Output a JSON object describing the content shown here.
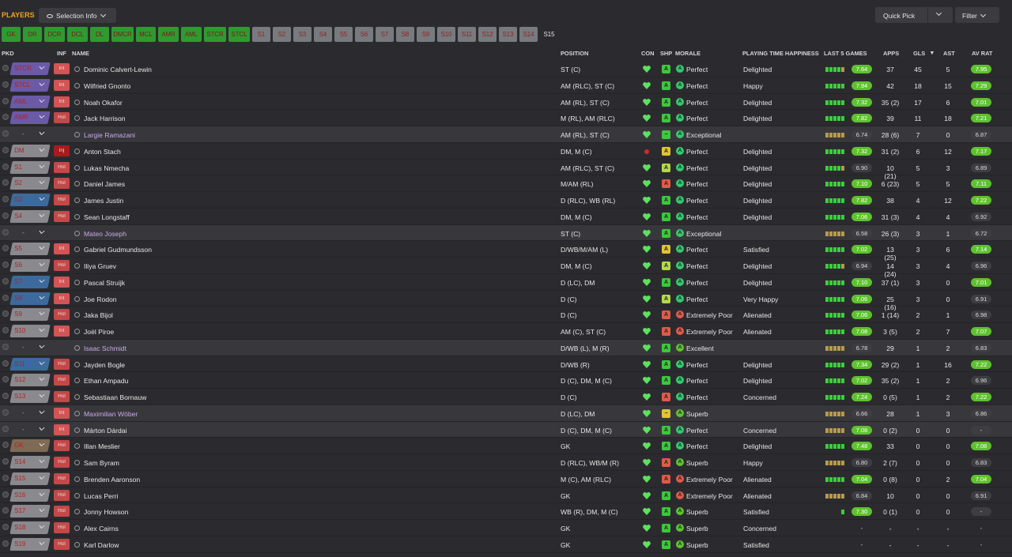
{
  "header": {
    "title": "PLAYERS",
    "selection_info": "Selection Info",
    "quick_pick": "Quick Pick",
    "filter": "Filter"
  },
  "tabs": [
    {
      "label": "GK",
      "style": "g"
    },
    {
      "label": "DR",
      "style": "g"
    },
    {
      "label": "DCR",
      "style": "g"
    },
    {
      "label": "DCL",
      "style": "g"
    },
    {
      "label": "DL",
      "style": "g"
    },
    {
      "label": "DMCR",
      "style": "g"
    },
    {
      "label": "MCL",
      "style": "g"
    },
    {
      "label": "AMR",
      "style": "g"
    },
    {
      "label": "AML",
      "style": "g"
    },
    {
      "label": "STCR",
      "style": "g"
    },
    {
      "label": "STCL",
      "style": "g"
    },
    {
      "label": "S1",
      "style": "n"
    },
    {
      "label": "S2",
      "style": "n"
    },
    {
      "label": "S3",
      "style": "n"
    },
    {
      "label": "S4",
      "style": "n"
    },
    {
      "label": "S5",
      "style": "n"
    },
    {
      "label": "S6",
      "style": "n"
    },
    {
      "label": "S7",
      "style": "n"
    },
    {
      "label": "S8",
      "style": "n"
    },
    {
      "label": "S9",
      "style": "n"
    },
    {
      "label": "S10",
      "style": "n"
    },
    {
      "label": "S11",
      "style": "n"
    },
    {
      "label": "S12",
      "style": "n"
    },
    {
      "label": "S13",
      "style": "n"
    },
    {
      "label": "S14",
      "style": "n"
    },
    {
      "label": "S15",
      "style": "a"
    }
  ],
  "columns": {
    "pkd": "PKD",
    "inf": "INF",
    "name": "NAME",
    "position": "POSITION",
    "con": "CON",
    "shp": "SHP",
    "morale": "MORALE",
    "pth": "PLAYING TIME HAPPINESS",
    "last5": "LAST 5 GAMES",
    "apps": "APPS",
    "gls": "GLS",
    "ast": "AST",
    "avrat": "AV RAT"
  },
  "colors": {
    "accent": "#f0a21d",
    "rating_high": "#5ec22e",
    "green_tab": "#2f9a2f",
    "grey_tab": "#777a7e"
  },
  "players": [
    {
      "slot": "STCR",
      "slotc": "pur",
      "inf": "Int",
      "name": "Dominic Calvert-Lewin",
      "pos": "ST (C)",
      "con": "h",
      "shp": "A",
      "shc": "#3cc83c",
      "moi": "A",
      "moc": "#35c96a",
      "morale": "Perfect",
      "pth": "Delighted",
      "l5": "hhhhg",
      "rate": "7.64",
      "rc": "hi",
      "apps": "37",
      "gls": "45",
      "ast": "5",
      "av": "7.95",
      "ac": "hi",
      "nc": ""
    },
    {
      "slot": "STCL",
      "slotc": "pur",
      "inf": "Int",
      "name": "Wilfried Gnonto",
      "pos": "AM (RLC), ST (C)",
      "con": "h",
      "shp": "A",
      "shc": "#3cc83c",
      "moi": "A",
      "moc": "#35c96a",
      "morale": "Perfect",
      "pth": "Happy",
      "l5": "hhhhh",
      "rate": "7.94",
      "rc": "hi",
      "apps": "42",
      "gls": "18",
      "ast": "15",
      "av": "7.29",
      "ac": "hi",
      "nc": ""
    },
    {
      "slot": "AML",
      "slotc": "pur",
      "inf": "Int",
      "name": "Noah Okafor",
      "pos": "AM (RL), ST (C)",
      "con": "h",
      "shp": "A",
      "shc": "#3cc83c",
      "moi": "A",
      "moc": "#35c96a",
      "morale": "Perfect",
      "pth": "Delighted",
      "l5": "hhhhh",
      "rate": "7.32",
      "rc": "hi",
      "apps": "35 (2)",
      "gls": "17",
      "ast": "6",
      "av": "7.01",
      "ac": "hi",
      "nc": ""
    },
    {
      "slot": "AMR",
      "slotc": "pur",
      "inf": "Hol",
      "name": "Jack Harrison",
      "pos": "M (RL), AM (RLC)",
      "con": "h",
      "shp": "A",
      "shc": "#3cc83c",
      "moi": "A",
      "moc": "#35c96a",
      "morale": "Perfect",
      "pth": "Delighted",
      "l5": "hhhhh",
      "rate": "7.82",
      "rc": "hi",
      "apps": "39",
      "gls": "11",
      "ast": "18",
      "av": "7.21",
      "ac": "hi",
      "nc": ""
    },
    {
      "slot": "-",
      "slotc": "non",
      "inf": "",
      "name": "Largie Ramazani",
      "pos": "AM (RL), ST (C)",
      "con": "h",
      "shp": "−",
      "shc": "#3cc83c",
      "moi": "A",
      "moc": "#35c96a",
      "morale": "Exceptional",
      "pth": "",
      "l5": "ggggg",
      "rate": "6.74",
      "rc": "lo",
      "apps": "28 (6)",
      "gls": "7",
      "ast": "0",
      "av": "6.87",
      "ac": "lo",
      "nc": "pur",
      "alt": true
    },
    {
      "slot": "DM",
      "slotc": "gry",
      "inf": "Inj",
      "name": "Anton Stach",
      "pos": "DM, M (C)",
      "con": "dot",
      "shp": "A",
      "shc": "#e0c435",
      "moi": "A",
      "moc": "#35c96a",
      "morale": "Perfect",
      "pth": "Delighted",
      "l5": "hhhhh",
      "rate": "7.32",
      "rc": "hi",
      "apps": "31 (2)",
      "gls": "6",
      "ast": "12",
      "av": "7.17",
      "ac": "hi",
      "nc": ""
    },
    {
      "slot": "S1",
      "slotc": "gry",
      "inf": "Hol",
      "name": "Lukas Nmecha",
      "pos": "AM (RLC), ST (C)",
      "con": "h",
      "shp": "A",
      "shc": "#b3d94a",
      "moi": "A",
      "moc": "#35c96a",
      "morale": "Perfect",
      "pth": "Delighted",
      "l5": "hhhhg",
      "rate": "6.90",
      "rc": "lo",
      "apps": "10 (21)",
      "gls": "5",
      "ast": "3",
      "av": "6.89",
      "ac": "lo",
      "nc": ""
    },
    {
      "slot": "S2",
      "slotc": "gry",
      "inf": "Hol",
      "name": "Daniel James",
      "pos": "M/AM (RL)",
      "con": "h",
      "shp": "A",
      "shc": "#e05a4a",
      "moi": "A",
      "moc": "#35c96a",
      "morale": "Perfect",
      "pth": "Delighted",
      "l5": "hhhhh",
      "rate": "7.10",
      "rc": "hi",
      "apps": "6 (23)",
      "gls": "5",
      "ast": "5",
      "av": "7.11",
      "ac": "hi",
      "nc": ""
    },
    {
      "slot": "S3",
      "slotc": "blu",
      "inf": "Hol",
      "name": "James Justin",
      "pos": "D (RLC), WB (RL)",
      "con": "h",
      "shp": "A",
      "shc": "#3cc83c",
      "moi": "A",
      "moc": "#35c96a",
      "morale": "Perfect",
      "pth": "Delighted",
      "l5": "hhhhh",
      "rate": "7.82",
      "rc": "hi",
      "apps": "38",
      "gls": "4",
      "ast": "12",
      "av": "7.22",
      "ac": "hi",
      "nc": ""
    },
    {
      "slot": "S4",
      "slotc": "gry",
      "inf": "Hol",
      "name": "Sean Longstaff",
      "pos": "DM, M (C)",
      "con": "h",
      "shp": "A",
      "shc": "#3cc83c",
      "moi": "A",
      "moc": "#35c96a",
      "morale": "Perfect",
      "pth": "Delighted",
      "l5": "hhhhh",
      "rate": "7.06",
      "rc": "hi",
      "apps": "31 (3)",
      "gls": "4",
      "ast": "4",
      "av": "6.92",
      "ac": "lo",
      "nc": ""
    },
    {
      "slot": "-",
      "slotc": "non",
      "inf": "",
      "name": "Mateo Joseph",
      "pos": "ST (C)",
      "con": "h",
      "shp": "A",
      "shc": "#3cc83c",
      "moi": "A",
      "moc": "#35c96a",
      "morale": "Exceptional",
      "pth": "",
      "l5": "ggggg",
      "rate": "6.58",
      "rc": "lo",
      "apps": "26 (3)",
      "gls": "3",
      "ast": "1",
      "av": "6.72",
      "ac": "lo",
      "nc": "pur",
      "alt": true
    },
    {
      "slot": "S5",
      "slotc": "gry",
      "inf": "Int",
      "name": "Gabriel Gudmundsson",
      "pos": "D/WB/M/AM (L)",
      "con": "h",
      "shp": "A",
      "shc": "#e0c435",
      "moi": "A",
      "moc": "#35c96a",
      "morale": "Perfect",
      "pth": "Satisfied",
      "l5": "hhhhh",
      "rate": "7.02",
      "rc": "hi",
      "apps": "13 (25)",
      "gls": "3",
      "ast": "6",
      "av": "7.14",
      "ac": "hi",
      "nc": ""
    },
    {
      "slot": "S6",
      "slotc": "gry",
      "inf": "Hol",
      "name": "Iliya Gruev",
      "pos": "DM, M (C)",
      "con": "h",
      "shp": "A",
      "shc": "#b3d94a",
      "moi": "A",
      "moc": "#35c96a",
      "morale": "Perfect",
      "pth": "Delighted",
      "l5": "hhhhg",
      "rate": "6.94",
      "rc": "lo",
      "apps": "14 (24)",
      "gls": "3",
      "ast": "4",
      "av": "6.96",
      "ac": "lo",
      "nc": ""
    },
    {
      "slot": "S7",
      "slotc": "blu",
      "inf": "Int",
      "name": "Pascal Struijk",
      "pos": "D (LC), DM",
      "con": "h",
      "shp": "A",
      "shc": "#3cc83c",
      "moi": "A",
      "moc": "#35c96a",
      "morale": "Perfect",
      "pth": "Delighted",
      "l5": "hhhhh",
      "rate": "7.10",
      "rc": "hi",
      "apps": "37 (1)",
      "gls": "3",
      "ast": "0",
      "av": "7.01",
      "ac": "hi",
      "nc": ""
    },
    {
      "slot": "S8",
      "slotc": "blu",
      "inf": "Int",
      "name": "Joe Rodon",
      "pos": "D (C)",
      "con": "h",
      "shp": "A",
      "shc": "#b3d94a",
      "moi": "A",
      "moc": "#35c96a",
      "morale": "Perfect",
      "pth": "Very Happy",
      "l5": "hhhhh",
      "rate": "7.06",
      "rc": "hi",
      "apps": "25 (16)",
      "gls": "3",
      "ast": "0",
      "av": "6.91",
      "ac": "lo",
      "nc": ""
    },
    {
      "slot": "S9",
      "slotc": "gry",
      "inf": "Hol",
      "name": "Jaka Bijol",
      "pos": "D (C)",
      "con": "h",
      "shp": "A",
      "shc": "#e05a4a",
      "moi": "A",
      "moc": "#e05a4a",
      "morale": "Extremely Poor",
      "pth": "Alienated",
      "l5": "hhhhh",
      "rate": "7.06",
      "rc": "hi",
      "apps": "1 (14)",
      "gls": "2",
      "ast": "1",
      "av": "6.98",
      "ac": "lo",
      "nc": ""
    },
    {
      "slot": "S10",
      "slotc": "gry",
      "inf": "Int",
      "name": "Joël Piroe",
      "pos": "AM (C), ST (C)",
      "con": "h",
      "shp": "A",
      "shc": "#e05a4a",
      "moi": "A",
      "moc": "#e05a4a",
      "morale": "Extremely Poor",
      "pth": "Alienated",
      "l5": "hhhhh",
      "rate": "7.08",
      "rc": "hi",
      "apps": "3 (5)",
      "gls": "2",
      "ast": "7",
      "av": "7.07",
      "ac": "hi",
      "nc": ""
    },
    {
      "slot": "-",
      "slotc": "non",
      "inf": "",
      "name": "Isaac Schmidt",
      "pos": "D/WB (L), M (R)",
      "con": "h",
      "shp": "A",
      "shc": "#3cc83c",
      "moi": "A",
      "moc": "#5ec22e",
      "morale": "Excellent",
      "pth": "",
      "l5": "ggggg",
      "rate": "6.78",
      "rc": "lo",
      "apps": "29",
      "gls": "1",
      "ast": "2",
      "av": "6.83",
      "ac": "lo",
      "nc": "pur",
      "alt": true
    },
    {
      "slot": "S11",
      "slotc": "blu",
      "inf": "Hol",
      "name": "Jayden Bogle",
      "pos": "D/WB (R)",
      "con": "h",
      "shp": "A",
      "shc": "#3cc83c",
      "moi": "A",
      "moc": "#35c96a",
      "morale": "Perfect",
      "pth": "Delighted",
      "l5": "hhhhh",
      "rate": "7.34",
      "rc": "hi",
      "apps": "29 (2)",
      "gls": "1",
      "ast": "16",
      "av": "7.22",
      "ac": "hi",
      "nc": ""
    },
    {
      "slot": "S12",
      "slotc": "gry",
      "inf": "Hol",
      "name": "Ethan Ampadu",
      "pos": "D (C), DM, M (C)",
      "con": "h",
      "shp": "A",
      "shc": "#3cc83c",
      "moi": "A",
      "moc": "#35c96a",
      "morale": "Perfect",
      "pth": "Delighted",
      "l5": "hhhhh",
      "rate": "7.02",
      "rc": "hi",
      "apps": "35 (2)",
      "gls": "1",
      "ast": "2",
      "av": "6.96",
      "ac": "lo",
      "nc": ""
    },
    {
      "slot": "S13",
      "slotc": "gry",
      "inf": "Hol",
      "name": "Sebastiaan Bornauw",
      "pos": "D (C)",
      "con": "h",
      "shp": "A",
      "shc": "#e05a4a",
      "moi": "A",
      "moc": "#35c96a",
      "morale": "Perfect",
      "pth": "Concerned",
      "l5": "hhhhh",
      "rate": "7.24",
      "rc": "hi",
      "apps": "0 (5)",
      "gls": "1",
      "ast": "2",
      "av": "7.22",
      "ac": "hi",
      "nc": ""
    },
    {
      "slot": "-",
      "slotc": "non",
      "inf": "Int",
      "name": "Maximilian Wöber",
      "pos": "D (LC), DM",
      "con": "h",
      "shp": "−",
      "shc": "#e0c435",
      "moi": "A",
      "moc": "#5ec22e",
      "morale": "Superb",
      "pth": "",
      "l5": "ggggg",
      "rate": "6.66",
      "rc": "lo",
      "apps": "28",
      "gls": "1",
      "ast": "3",
      "av": "6.86",
      "ac": "lo",
      "nc": "pur",
      "alt": true
    },
    {
      "slot": "-",
      "slotc": "non",
      "inf": "Int",
      "name": "Márton Dárdai",
      "pos": "D (C), DM, M (C)",
      "con": "h",
      "shp": "A",
      "shc": "#3cc83c",
      "moi": "A",
      "moc": "#35c96a",
      "morale": "Perfect",
      "pth": "Concerned",
      "l5": "ggggg",
      "rate": "7.08",
      "rc": "hi",
      "apps": "0 (2)",
      "gls": "0",
      "ast": "0",
      "av": "-",
      "ac": "lo",
      "nc": "",
      "alt": true
    },
    {
      "slot": "GK",
      "slotc": "ora",
      "inf": "Hol",
      "name": "Illan Meslier",
      "pos": "GK",
      "con": "h",
      "shp": "A",
      "shc": "#3cc83c",
      "moi": "A",
      "moc": "#35c96a",
      "morale": "Perfect",
      "pth": "Delighted",
      "l5": "hhhhh",
      "rate": "7.48",
      "rc": "hi",
      "apps": "33",
      "gls": "0",
      "ast": "0",
      "av": "7.08",
      "ac": "hi",
      "nc": ""
    },
    {
      "slot": "S14",
      "slotc": "gry",
      "inf": "Hol",
      "name": "Sam Byram",
      "pos": "D (RLC), WB/M (R)",
      "con": "h",
      "shp": "A",
      "shc": "#e05a4a",
      "moi": "A",
      "moc": "#5ec22e",
      "morale": "Superb",
      "pth": "Happy",
      "l5": "ggggg",
      "rate": "6.80",
      "rc": "lo",
      "apps": "2 (7)",
      "gls": "0",
      "ast": "0",
      "av": "6.83",
      "ac": "lo",
      "nc": ""
    },
    {
      "slot": "S15",
      "slotc": "gry",
      "inf": "Hol",
      "name": "Brenden Aaronson",
      "pos": "M (C), AM (RLC)",
      "con": "h",
      "shp": "A",
      "shc": "#e05a4a",
      "moi": "A",
      "moc": "#e05a4a",
      "morale": "Extremely Poor",
      "pth": "Alienated",
      "l5": "hhhhh",
      "rate": "7.04",
      "rc": "hi",
      "apps": "0 (8)",
      "gls": "0",
      "ast": "2",
      "av": "7.04",
      "ac": "hi",
      "nc": ""
    },
    {
      "slot": "S16",
      "slotc": "gry",
      "inf": "Hol",
      "name": "Lucas Perri",
      "pos": "GK",
      "con": "h",
      "shp": "A",
      "shc": "#3cc83c",
      "moi": "A",
      "moc": "#e05a4a",
      "morale": "Extremely Poor",
      "pth": "Alienated",
      "l5": "ggggg",
      "rate": "6.84",
      "rc": "lo",
      "apps": "10",
      "gls": "0",
      "ast": "0",
      "av": "6.91",
      "ac": "lo",
      "nc": ""
    },
    {
      "slot": "S17",
      "slotc": "gry",
      "inf": "Hol",
      "name": "Jonny Howson",
      "pos": "WB (R), DM, M (C)",
      "con": "h",
      "shp": "A",
      "shc": "#3cc83c",
      "moi": "A",
      "moc": "#5ec22e",
      "morale": "Superb",
      "pth": "Satisfied",
      "l5": "    h",
      "rate": "7.30",
      "rc": "hi",
      "apps": "0 (1)",
      "gls": "0",
      "ast": "0",
      "av": "-",
      "ac": "lo",
      "nc": ""
    },
    {
      "slot": "S18",
      "slotc": "gry",
      "inf": "Hol",
      "name": "Alex Cairns",
      "pos": "GK",
      "con": "h",
      "shp": "A",
      "shc": "#3cc83c",
      "moi": "A",
      "moc": "#5ec22e",
      "morale": "Superb",
      "pth": "Concerned",
      "l5": "",
      "rate": "-",
      "rc": "lo",
      "apps": "-",
      "gls": "-",
      "ast": "-",
      "av": "-",
      "ac": "lo",
      "nc": ""
    },
    {
      "slot": "S19",
      "slotc": "gry",
      "inf": "Hol",
      "name": "Karl Darlow",
      "pos": "GK",
      "con": "h",
      "shp": "A",
      "shc": "#3cc83c",
      "moi": "A",
      "moc": "#5ec22e",
      "morale": "Superb",
      "pth": "Satisfied",
      "l5": "",
      "rate": "-",
      "rc": "lo",
      "apps": "-",
      "gls": "-",
      "ast": "-",
      "av": "-",
      "ac": "lo",
      "nc": ""
    }
  ]
}
